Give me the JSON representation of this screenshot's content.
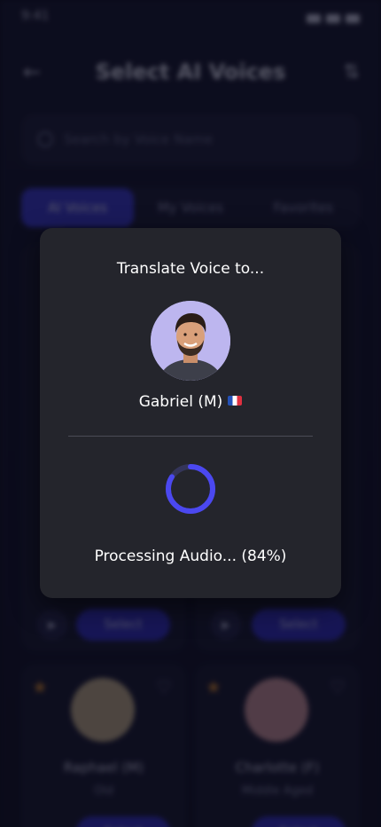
{
  "status_bar": {
    "time": "9:41"
  },
  "header": {
    "title": "Select AI Voices"
  },
  "search": {
    "placeholder": "Search by Voice Name"
  },
  "tabs": [
    "AI Voices",
    "My Voices",
    "Favorites"
  ],
  "cards": {
    "select_label": "Select",
    "bottom": [
      {
        "name": "Raphael (M)",
        "age": "Old"
      },
      {
        "name": "Charlotte (F)",
        "age": "Middle Aged"
      }
    ]
  },
  "modal": {
    "title": "Translate Voice to...",
    "voice_name": "Gabriel (M)",
    "progress_text": "Processing Audio... (84%)",
    "progress": 0.84
  },
  "colors": {
    "accent": "#4b48f0",
    "modal_bg": "#24252c",
    "page_bg": "#0c0d1c"
  }
}
